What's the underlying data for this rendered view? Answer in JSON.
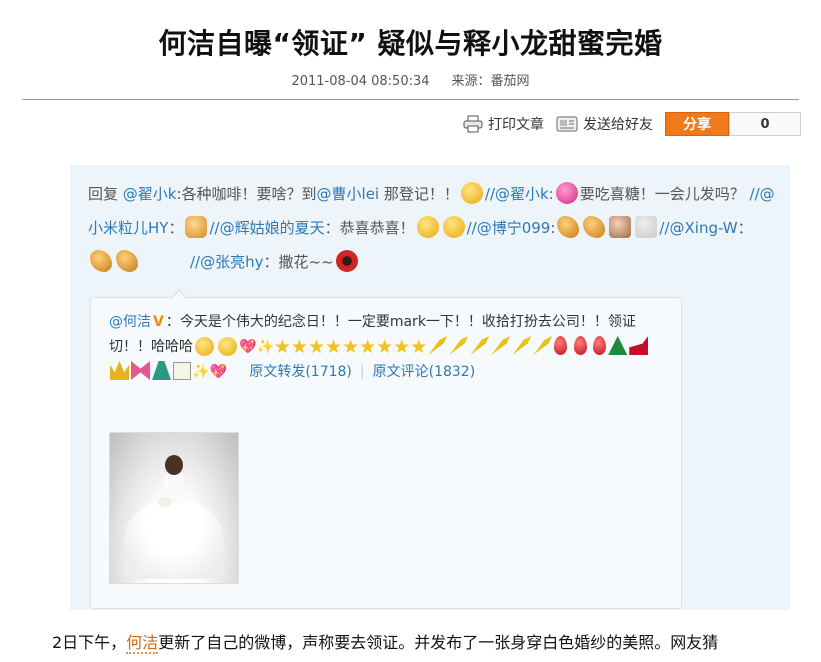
{
  "article": {
    "title": "何洁自曝“领证” 疑似与释小龙甜蜜完婚",
    "date": "2011-08-04 08:50:34",
    "source": "来源：番茄网"
  },
  "toolbar": {
    "print_label": "打印文章",
    "send_label": "发送给好友",
    "share_label": "分享",
    "share_count": "0"
  },
  "weibo": {
    "t1": "回复 ",
    "u1": "@翟小k",
    "t2": ":各种咖啡！要啥？到",
    "u2": "@曹小lei",
    "t3": " 那登记！！",
    "u3": "//@翟小k:",
    "t4": "要吃喜糖！一会儿发吗？ ",
    "u4": "//@小米粒儿HY",
    "t5": "：",
    "u5": "//@辉姑娘的夏天",
    "t6": "：恭喜恭喜！",
    "u6": "//@博宁099",
    "t7": ":",
    "u7": "//@Xing-W",
    "t8": "：",
    "u8": "//@张亮hy",
    "t9": "：撒花~~"
  },
  "retweet": {
    "user": "@何洁",
    "verified": "V",
    "text": "：今天是个伟大的纪念日！！一定要mark一下！！收拾打扮去公司！！领证切！！哈哈哈",
    "forward_label": "原文转发(1718)",
    "comment_label": "原文评论(1832)"
  },
  "body": {
    "p1_before": "2日下午，",
    "p1_name": "何洁",
    "p1_after": "更新了自己的微博，声称要去领证。并发布了一张身穿白色婚纱的美照。网友猜"
  }
}
